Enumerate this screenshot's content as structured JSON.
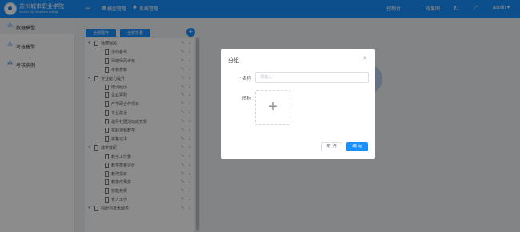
{
  "header": {
    "school_name": "苏州城市职业学院",
    "school_en": "Suzhou City Vocational College",
    "nav": [
      "模型管理",
      "系统管理"
    ],
    "links": [
      "控制台",
      "效果图"
    ],
    "user": "admin"
  },
  "sidebar": {
    "items": [
      {
        "label": "数据模型",
        "active": true
      },
      {
        "label": "考核模型",
        "active": false
      },
      {
        "label": "考核实例",
        "active": false
      }
    ]
  },
  "tree": {
    "expand_all": "全部展开",
    "collapse_all": "全部折叠",
    "nodes": [
      {
        "label": "师德师风",
        "level": 0
      },
      {
        "label": "活动参与",
        "level": 1
      },
      {
        "label": "师德师风考核",
        "level": 1
      },
      {
        "label": "考核表彰",
        "level": 1
      },
      {
        "label": "专业能力提升",
        "level": 0
      },
      {
        "label": "培训经历",
        "level": 1
      },
      {
        "label": "企业实践",
        "level": 1
      },
      {
        "label": "产学研合作项目",
        "level": 1
      },
      {
        "label": "专业建设",
        "level": 1
      },
      {
        "label": "指导社团活动或竞赛",
        "level": 1
      },
      {
        "label": "实践课程教学",
        "level": 1
      },
      {
        "label": "资格证书",
        "level": 1
      },
      {
        "label": "教学教研",
        "level": 0
      },
      {
        "label": "教学工作量",
        "level": 1
      },
      {
        "label": "教学质量评价",
        "level": 1
      },
      {
        "label": "教改项目",
        "level": 1
      },
      {
        "label": "教学成果奖",
        "level": 1
      },
      {
        "label": "技能竞赛",
        "level": 1
      },
      {
        "label": "育人工作",
        "level": 1
      },
      {
        "label": "科研与技术服务",
        "level": 0
      }
    ]
  },
  "dialog": {
    "title": "分组",
    "name_label": "名称",
    "name_placeholder": "请输入",
    "icon_label": "图标",
    "cancel": "取 消",
    "confirm": "确 定"
  },
  "colors": {
    "primary": "#1890ff",
    "sidebar_icon": "#2c7be5"
  }
}
